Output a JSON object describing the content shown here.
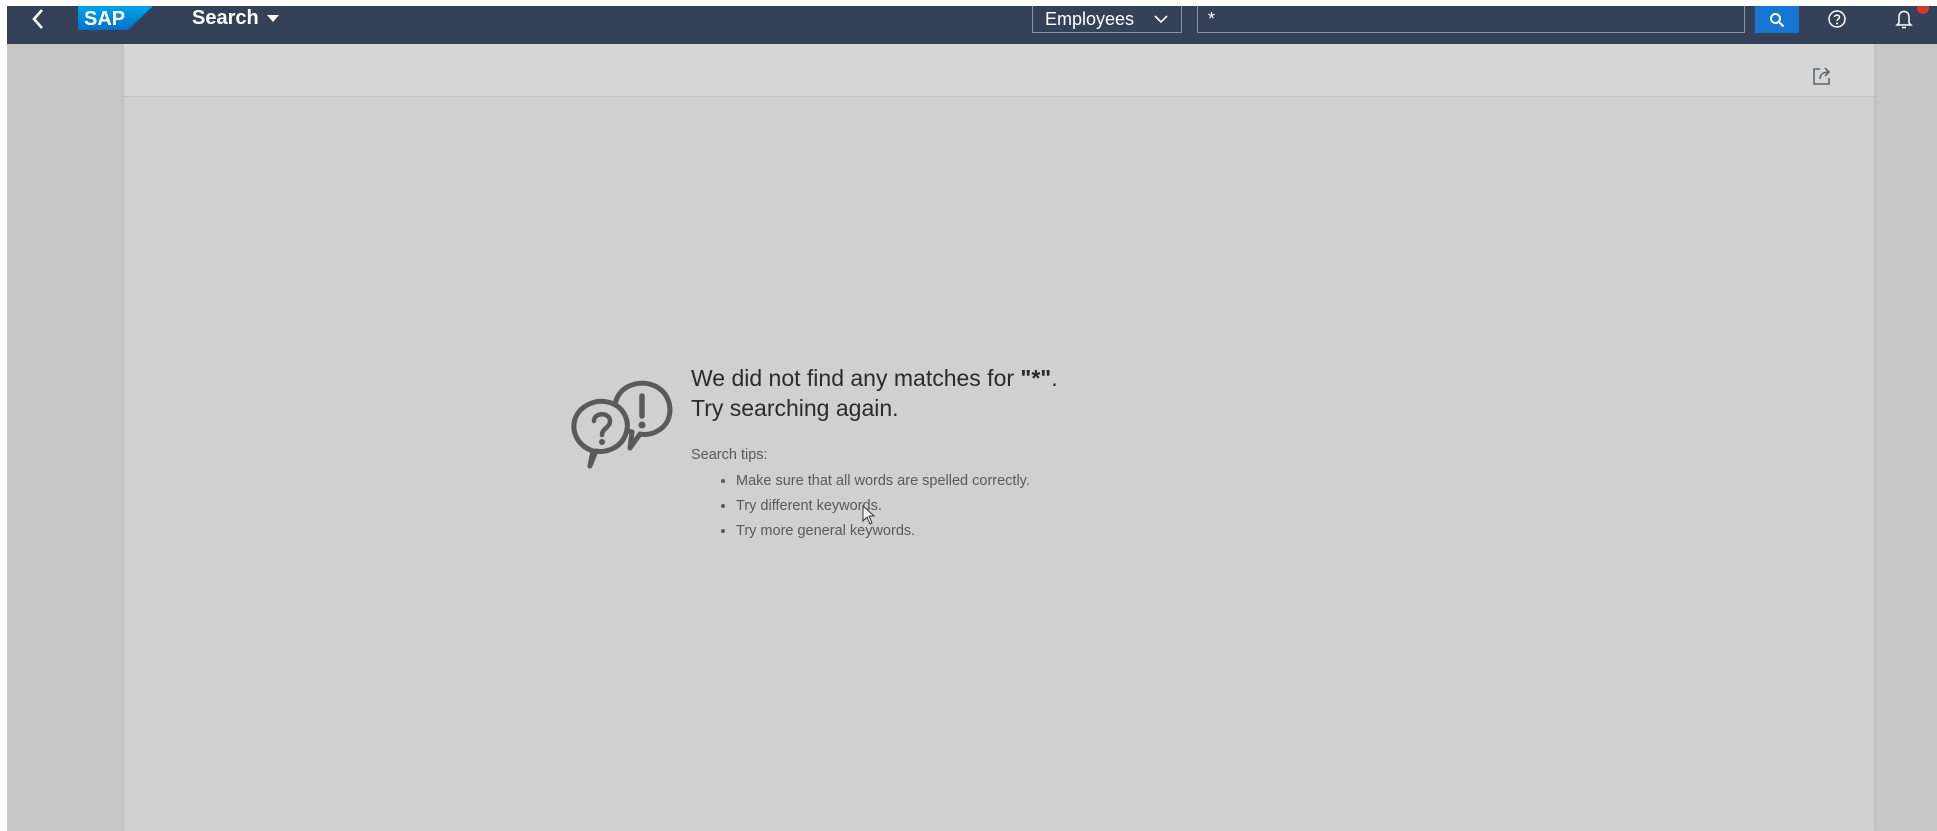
{
  "shellbar": {
    "title": "Search",
    "logo_text": "SAP",
    "scope_value": "Employees",
    "search_value": "*",
    "icons": {
      "back": "back-icon",
      "search": "search-icon",
      "help": "help-icon",
      "notifications": "bell-icon"
    },
    "colors": {
      "bar": "#344259",
      "search_button": "#1677d2",
      "notification_badge": "#d9362d"
    }
  },
  "toolbar": {
    "share_icon": "share-icon"
  },
  "empty_state": {
    "illustration_icon": "question-exclamation-bubbles-icon",
    "title_line1_prefix": "We did not find any matches for ",
    "title_query": "\"*\"",
    "title_line1_suffix": ".",
    "title_line2": "Try searching again.",
    "tips_label": "Search tips:",
    "tips": [
      "Make sure that all words are spelled correctly.",
      "Try different keywords.",
      "Try more general keywords."
    ]
  }
}
